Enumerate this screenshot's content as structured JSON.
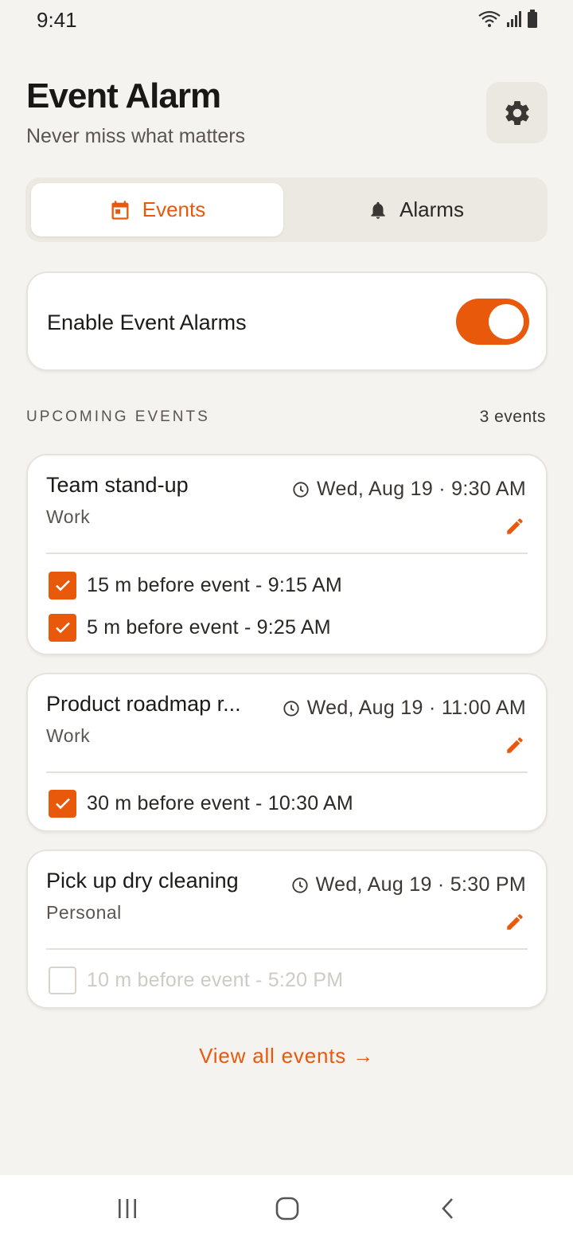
{
  "status": {
    "time": "9:41"
  },
  "header": {
    "title": "Event Alarm",
    "subtitle": "Never miss what matters"
  },
  "tabs": [
    {
      "label": "Events",
      "icon": "calendar-icon",
      "active": true
    },
    {
      "label": "Alarms",
      "icon": "bell-icon",
      "active": false
    }
  ],
  "toggle": {
    "label": "Enable Event Alarms",
    "enabled": true
  },
  "section": {
    "heading": "UPCOMING EVENTS",
    "count": "3 events"
  },
  "events": [
    {
      "title": "Team stand-up",
      "category": "Work",
      "time": "Wed, Aug 19 · 9:30 AM",
      "alarms": [
        {
          "text": "15 m before event - 9:15 AM",
          "checked": true
        },
        {
          "text": "5 m before event - 9:25 AM",
          "checked": true
        }
      ]
    },
    {
      "title": "Product roadmap r...",
      "category": "Work",
      "time": "Wed, Aug 19 · 11:00 AM",
      "alarms": [
        {
          "text": "30 m before event - 10:30 AM",
          "checked": true
        }
      ]
    },
    {
      "title": "Pick up dry cleaning",
      "category": "Personal",
      "time": "Wed, Aug 19 · 5:30 PM",
      "alarms": [
        {
          "text": "10 m before event - 5:20 PM",
          "checked": false
        }
      ]
    }
  ],
  "footer": {
    "view_all": "View all events →"
  },
  "colors": {
    "accent": "#e8590c",
    "background": "#f5f3ef",
    "card": "#ffffff"
  }
}
